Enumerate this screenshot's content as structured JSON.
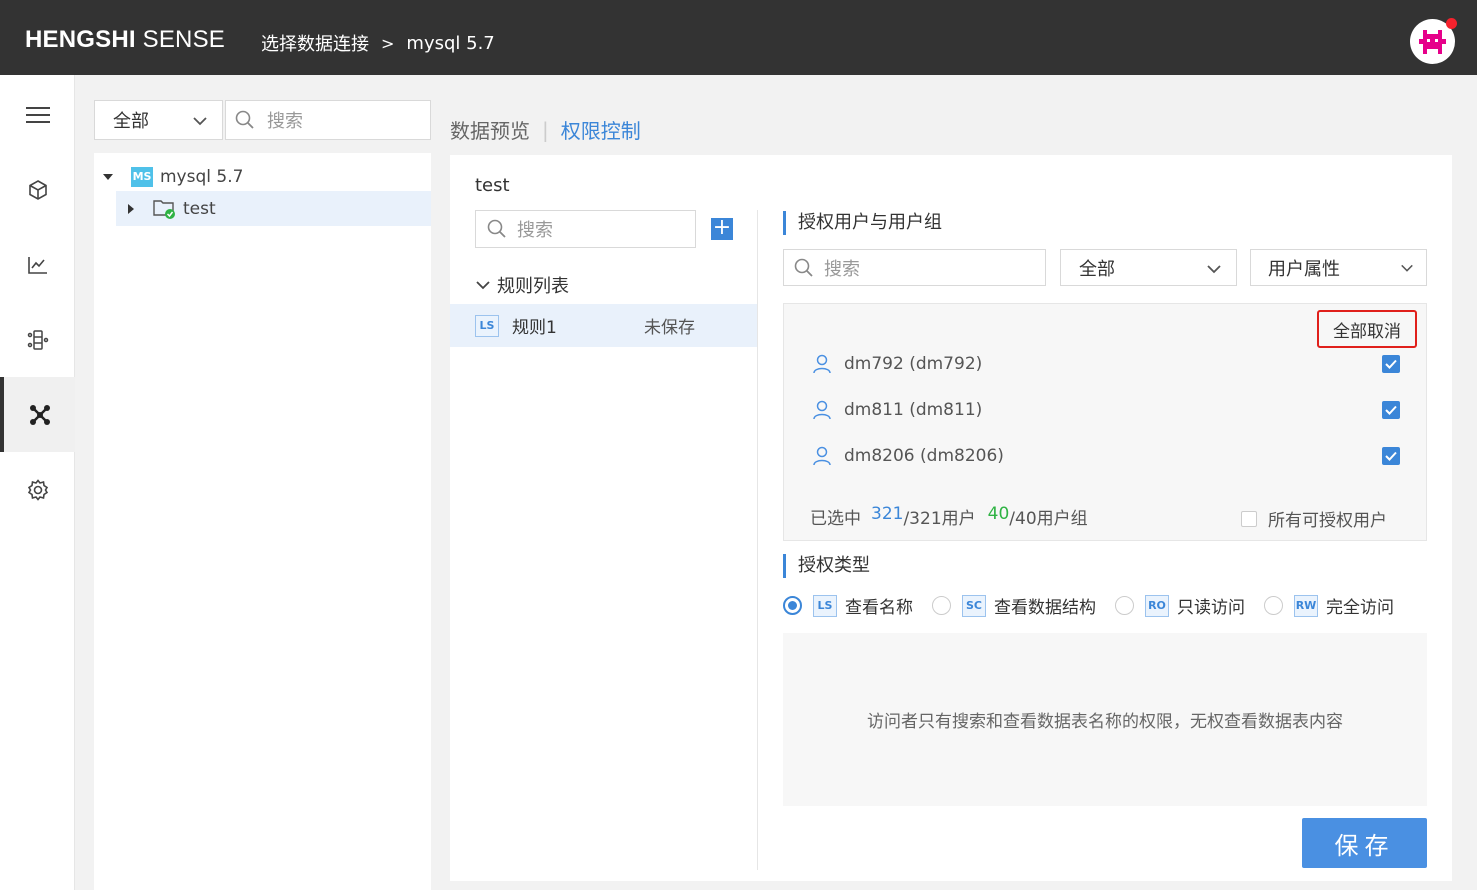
{
  "header": {
    "brand_bold": "HENGSHI",
    "brand_rest": "SENSE",
    "breadcrumb_1": "选择数据连接",
    "breadcrumb_sep": ">",
    "breadcrumb_2": "mysql 5.7"
  },
  "sidenav": {
    "items": [
      "menu-icon",
      "cube-icon",
      "chart-icon",
      "data-model-icon",
      "network-icon",
      "settings-icon"
    ],
    "active": "network-icon"
  },
  "left_panel": {
    "filter_value": "全部",
    "search_placeholder": "搜索",
    "tree": {
      "root_badge": "MS",
      "root_label": "mysql 5.7",
      "child_label": "test"
    }
  },
  "tabs": {
    "preview": "数据预览",
    "divider": "|",
    "permission": "权限控制"
  },
  "rules": {
    "title": "test",
    "search_placeholder": "搜索",
    "add_label": "+",
    "list_header": "规则列表",
    "items": [
      {
        "badge": "LS",
        "name": "规则1",
        "status": "未保存"
      }
    ]
  },
  "authorize": {
    "section_title": "授权用户与用户组",
    "search_placeholder": "搜索",
    "scope_value": "全部",
    "attr_value": "用户属性",
    "cancel_all": "全部取消",
    "users": [
      {
        "label": "dm792 (dm792)",
        "checked": true
      },
      {
        "label": "dm811 (dm811)",
        "checked": true
      },
      {
        "label": "dm8206 (dm8206)",
        "checked": true
      }
    ],
    "stat_prefix": "已选中",
    "users_selected": "321",
    "users_total": "/321用户",
    "groups_selected": "40",
    "groups_total": "/40用户组",
    "all_users_label": "所有可授权用户"
  },
  "auth_type": {
    "section_title": "授权类型",
    "options": [
      {
        "badge": "LS",
        "label": "查看名称",
        "selected": true
      },
      {
        "badge": "SC",
        "label": "查看数据结构",
        "selected": false
      },
      {
        "badge": "RO",
        "label": "只读访问",
        "selected": false
      },
      {
        "badge": "RW",
        "label": "完全访问",
        "selected": false
      }
    ],
    "description": "访问者只有搜索和查看数据表名称的权限，无权查看数据表内容"
  },
  "save_label": "保存",
  "colors": {
    "topbar": "#333333",
    "accent": "#3b86d8",
    "highlight_border": "#e0201b",
    "green": "#2fb344"
  }
}
